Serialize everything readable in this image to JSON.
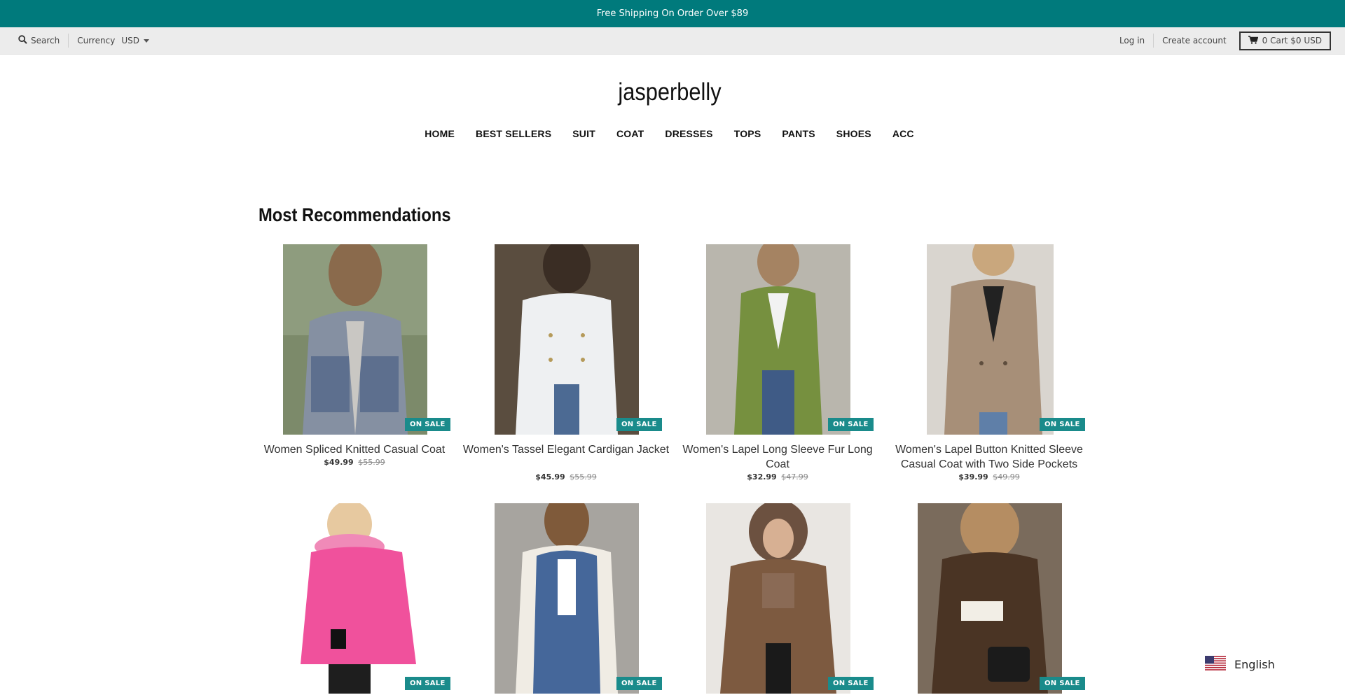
{
  "announcement": {
    "text": "Free Shipping On Order Over $89"
  },
  "utility": {
    "search_label": "Search",
    "currency_label": "Currency",
    "currency_value": "USD",
    "login_label": "Log in",
    "create_account_label": "Create account",
    "cart_label": "0 Cart $0 USD"
  },
  "brand": {
    "name": "jasperbelly"
  },
  "nav": {
    "items": [
      {
        "label": "HOME"
      },
      {
        "label": "BEST SELLERS"
      },
      {
        "label": "SUIT"
      },
      {
        "label": "COAT"
      },
      {
        "label": "DRESSES"
      },
      {
        "label": "TOPS"
      },
      {
        "label": "PANTS"
      },
      {
        "label": "SHOES"
      },
      {
        "label": "ACC"
      }
    ]
  },
  "section": {
    "title": "Most Recommendations"
  },
  "badge_label": "ON SALE",
  "products": [
    {
      "title": "Women Spliced Knitted Casual Coat",
      "price": "$49.99",
      "compare_price": "$55.99"
    },
    {
      "title": "Women's Tassel Elegant Cardigan Jacket",
      "price": "$45.99",
      "compare_price": "$55.99"
    },
    {
      "title": "Women's Lapel Long Sleeve Fur Long Coat",
      "price": "$32.99",
      "compare_price": "$47.99"
    },
    {
      "title": "Women's Lapel Button Knitted Sleeve Casual Coat with Two Side Pockets",
      "price": "$39.99",
      "compare_price": "$49.99"
    },
    {
      "title": "",
      "price": "",
      "compare_price": ""
    },
    {
      "title": "",
      "price": "",
      "compare_price": ""
    },
    {
      "title": "",
      "price": "",
      "compare_price": ""
    },
    {
      "title": "",
      "price": "",
      "compare_price": ""
    }
  ],
  "language": {
    "label": "English",
    "flag_icon": "us-flag-icon"
  },
  "colors": {
    "accent": "#007a7c",
    "badge": "#1a8b8b",
    "utility_bg": "#ececec"
  }
}
